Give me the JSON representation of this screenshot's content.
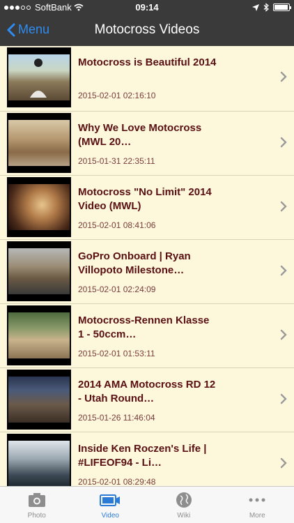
{
  "status": {
    "carrier": "SoftBank",
    "time": "09:14",
    "battery_level": 0.95
  },
  "nav": {
    "back_label": "Menu",
    "title": "Motocross Videos"
  },
  "videos": [
    {
      "title": "Motocross is Beautiful 2014",
      "date": "2015-02-01 02:16:10"
    },
    {
      "title": "Why We Love Motocross (MWL 20…",
      "date": "2015-01-31 22:35:11"
    },
    {
      "title": "Motocross \"No Limit\" 2014 Video (MWL)",
      "date": "2015-02-01 08:41:06"
    },
    {
      "title": "GoPro Onboard | Ryan Villopoto Milestone…",
      "date": "2015-02-01 02:24:09"
    },
    {
      "title": "Motocross-Rennen Klasse 1 - 50ccm…",
      "date": "2015-02-01 01:53:11"
    },
    {
      "title": "2014 AMA Motocross RD 12 - Utah Round…",
      "date": "2015-01-26 11:46:04"
    },
    {
      "title": "Inside Ken Roczen's Life | #LIFEOF94 - Li…",
      "date": "2015-02-01 08:29:48"
    }
  ],
  "tabs": [
    {
      "label": "Photo",
      "icon": "camera-icon",
      "active": false
    },
    {
      "label": "Video",
      "icon": "video-icon",
      "active": true
    },
    {
      "label": "Wiki",
      "icon": "globe-icon",
      "active": false
    },
    {
      "label": "More",
      "icon": "more-icon",
      "active": false
    }
  ],
  "colors": {
    "bar": "#3a3a3a",
    "accent": "#2f8cf0",
    "title": "#5a0f12",
    "list_bg": "#fdf8dc"
  }
}
